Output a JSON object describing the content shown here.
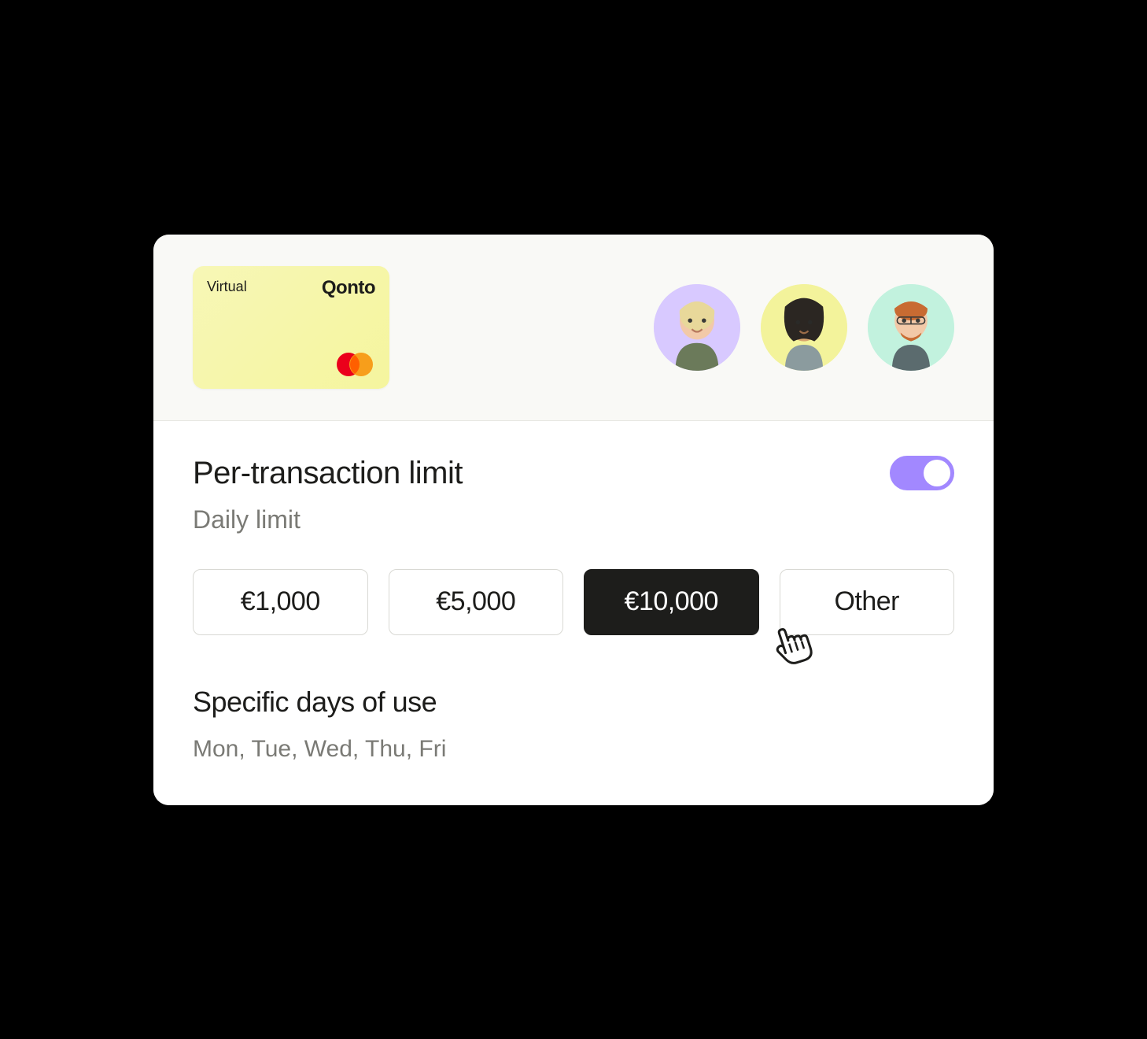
{
  "card": {
    "label": "Virtual",
    "brand": "Qonto"
  },
  "avatars": [
    {
      "bg": "#D8C9FF"
    },
    {
      "bg": "#F3F39B"
    },
    {
      "bg": "#C2F2DE"
    }
  ],
  "limits": {
    "title": "Per-transaction limit",
    "subtitle": "Daily limit",
    "toggle_on": true,
    "options": [
      {
        "label": "€1,000",
        "selected": false
      },
      {
        "label": "€5,000",
        "selected": false
      },
      {
        "label": "€10,000",
        "selected": true
      },
      {
        "label": "Other",
        "selected": false
      }
    ]
  },
  "days_section": {
    "title": "Specific days of use",
    "value": "Mon, Tue, Wed, Thu, Fri"
  }
}
